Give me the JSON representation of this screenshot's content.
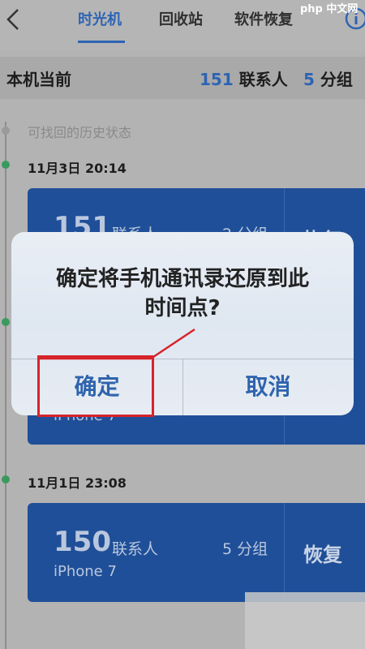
{
  "nav": {
    "tabs": [
      {
        "label": "时光机",
        "active": true
      },
      {
        "label": "回收站",
        "active": false
      },
      {
        "label": "软件恢复",
        "active": false
      }
    ],
    "icons": {
      "back": "chevron-left-icon",
      "info": "info-icon"
    }
  },
  "summary": {
    "label": "本机当前",
    "contacts_count": "151",
    "contacts_unit": "联系人",
    "groups_count": "5",
    "groups_unit": "分组"
  },
  "timeline": {
    "hint": "可找回的历史状态",
    "entries": [
      {
        "date": "11月3日  20:14",
        "contacts": "151",
        "contacts_unit": "联系人",
        "groups": "2 分组",
        "device": "iPhone 7",
        "action": "恢复"
      },
      {
        "date": "11月1日  23:08",
        "contacts": "150",
        "contacts_unit": "联系人",
        "groups": "5 分组",
        "device": "iPhone 7",
        "action": "恢复"
      }
    ]
  },
  "dialog": {
    "message_line1": "确定将手机通讯录还原到此",
    "message_line2": "时间点?",
    "confirm_label": "确定",
    "cancel_label": "取消"
  },
  "watermark": {
    "brand": "php 中文网"
  },
  "colors": {
    "accent": "#2d64b4",
    "card": "#1f4f98",
    "highlight": "#d7232b",
    "dot": "#3a9a5e"
  }
}
